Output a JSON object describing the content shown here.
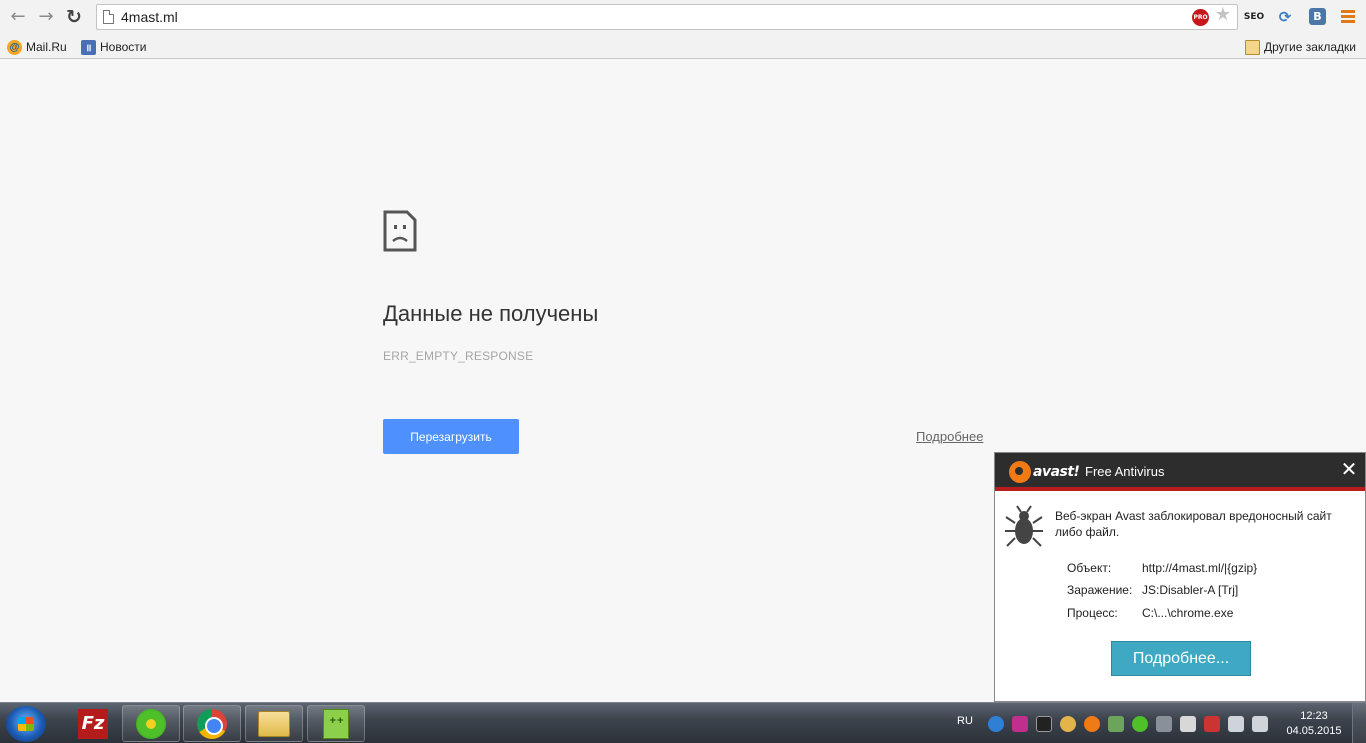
{
  "browser": {
    "url": "4mast.ml",
    "pro_badge": "PRO",
    "extensions": {
      "seo": "SEO",
      "vk": "B"
    }
  },
  "bookmarks": {
    "items": [
      {
        "label": "Mail.Ru",
        "icon": "mailru-icon"
      },
      {
        "label": "Новости",
        "icon": "news-icon"
      }
    ],
    "other": "Другие закладки"
  },
  "error_page": {
    "title": "Данные не получены",
    "code": "ERR_EMPTY_RESPONSE",
    "reload_label": "Перезагрузить",
    "details_label": "Подробнее"
  },
  "avast_popup": {
    "brand": "avast!",
    "product": "Free Antivirus",
    "message": "Веб-экран Avast заблокировал вредоносный сайт либо файл.",
    "rows": [
      {
        "label": "Объект:",
        "value": "http://4mast.ml/|{gzip}"
      },
      {
        "label": "Заражение:",
        "value": "JS:Disabler-A [Trj]"
      },
      {
        "label": "Процесс:",
        "value": "C:\\...\\chrome.exe"
      }
    ],
    "button_label": "Подробнее...",
    "accent": "#f07b14"
  },
  "taskbar": {
    "apps": [
      "filezilla-icon",
      "icq-icon",
      "chrome-icon",
      "file-manager-icon",
      "notepad-plus-plus-icon"
    ],
    "language": "RU",
    "time": "12:23",
    "date": "04.05.2015"
  }
}
